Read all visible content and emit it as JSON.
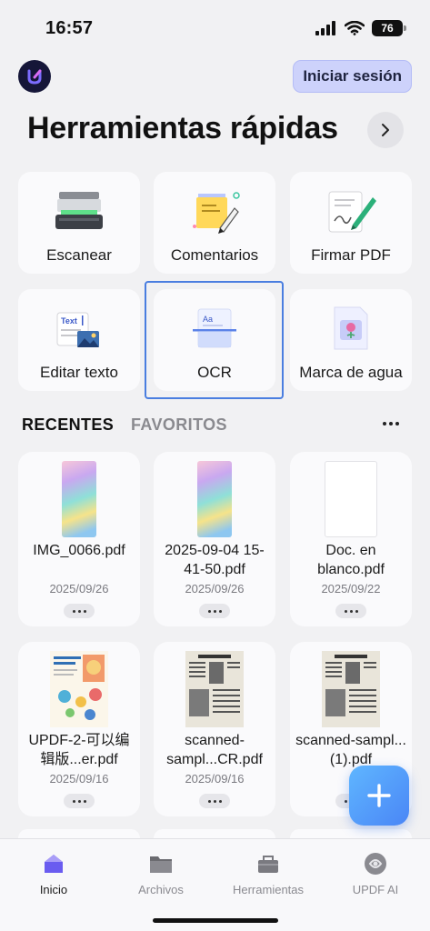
{
  "status": {
    "time": "16:57",
    "battery": "76"
  },
  "header": {
    "login_label": "Iniciar sesión",
    "title": "Herramientas rápidas"
  },
  "tools": [
    {
      "label": "Escanear",
      "icon": "scanner-icon"
    },
    {
      "label": "Comentarios",
      "icon": "sticky-note-icon"
    },
    {
      "label": "Firmar PDF",
      "icon": "signature-icon"
    },
    {
      "label": "Editar texto",
      "icon": "edit-text-icon"
    },
    {
      "label": "OCR",
      "icon": "ocr-icon"
    },
    {
      "label": "Marca de agua",
      "icon": "watermark-icon"
    }
  ],
  "tabs": {
    "recent": "RECENTES",
    "favorites": "FAVORITOS"
  },
  "files": [
    {
      "name": "IMG_0066.pdf",
      "date": "2025/09/26",
      "thumb": "gradient"
    },
    {
      "name": "2025-09-04 15-41-50.pdf",
      "date": "2025/09/26",
      "thumb": "gradient"
    },
    {
      "name": "Doc. en blanco.pdf",
      "date": "2025/09/22",
      "thumb": "blank"
    },
    {
      "name": "UPDF-2-可以编辑版...er.pdf",
      "date": "2025/09/16",
      "thumb": "brochure"
    },
    {
      "name": "scanned-sampl...CR.pdf",
      "date": "2025/09/16",
      "thumb": "newspaper"
    },
    {
      "name": "scanned-sampl...(1).pdf",
      "date": "",
      "thumb": "newspaper"
    }
  ],
  "nav": [
    {
      "label": "Inicio",
      "icon": "home-icon",
      "active": true
    },
    {
      "label": "Archivos",
      "icon": "folder-icon",
      "active": false
    },
    {
      "label": "Herramientas",
      "icon": "toolbox-icon",
      "active": false
    },
    {
      "label": "UPDF AI",
      "icon": "ai-icon",
      "active": false
    }
  ],
  "colors": {
    "accent": "#4a7ee0",
    "login_bg": "#cdd2fb",
    "fab": "#4a86f6",
    "active_nav": "#6a5cf0"
  }
}
